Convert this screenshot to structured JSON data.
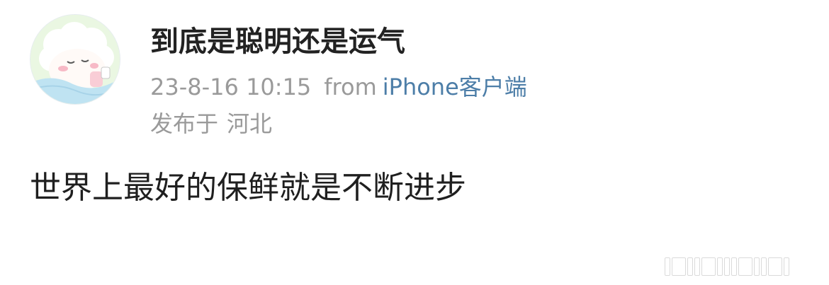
{
  "user": {
    "name": "到底是聪明还是运气",
    "avatar_icon": "cartoon-sheep-avatar-icon"
  },
  "meta": {
    "datetime": "23-8-16 10:15",
    "from_label": "from",
    "source": "iPhone客户端",
    "source_color": "#4d7ea8"
  },
  "location": {
    "prefix": "发布于",
    "place": "河北"
  },
  "post": {
    "text": "世界上最好的保鲜就是不断进步"
  },
  "colors": {
    "meta_gray": "#9a9a9a",
    "text_dark": "#1f1f1f",
    "background": "#ffffff"
  }
}
